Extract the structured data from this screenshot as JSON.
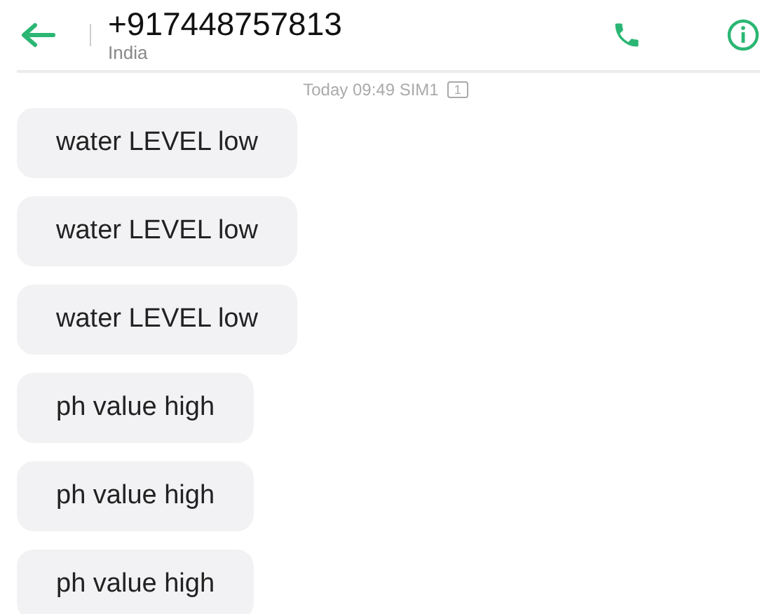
{
  "header": {
    "title": "+917448757813",
    "subtitle": "India"
  },
  "timestamp": {
    "text": "Today 09:49  SIM1",
    "sim_badge": "1"
  },
  "messages": [
    {
      "text": "water LEVEL low"
    },
    {
      "text": "water LEVEL low"
    },
    {
      "text": "water LEVEL low"
    },
    {
      "text": "ph value high"
    },
    {
      "text": "ph value high"
    },
    {
      "text": "ph value high"
    }
  ]
}
